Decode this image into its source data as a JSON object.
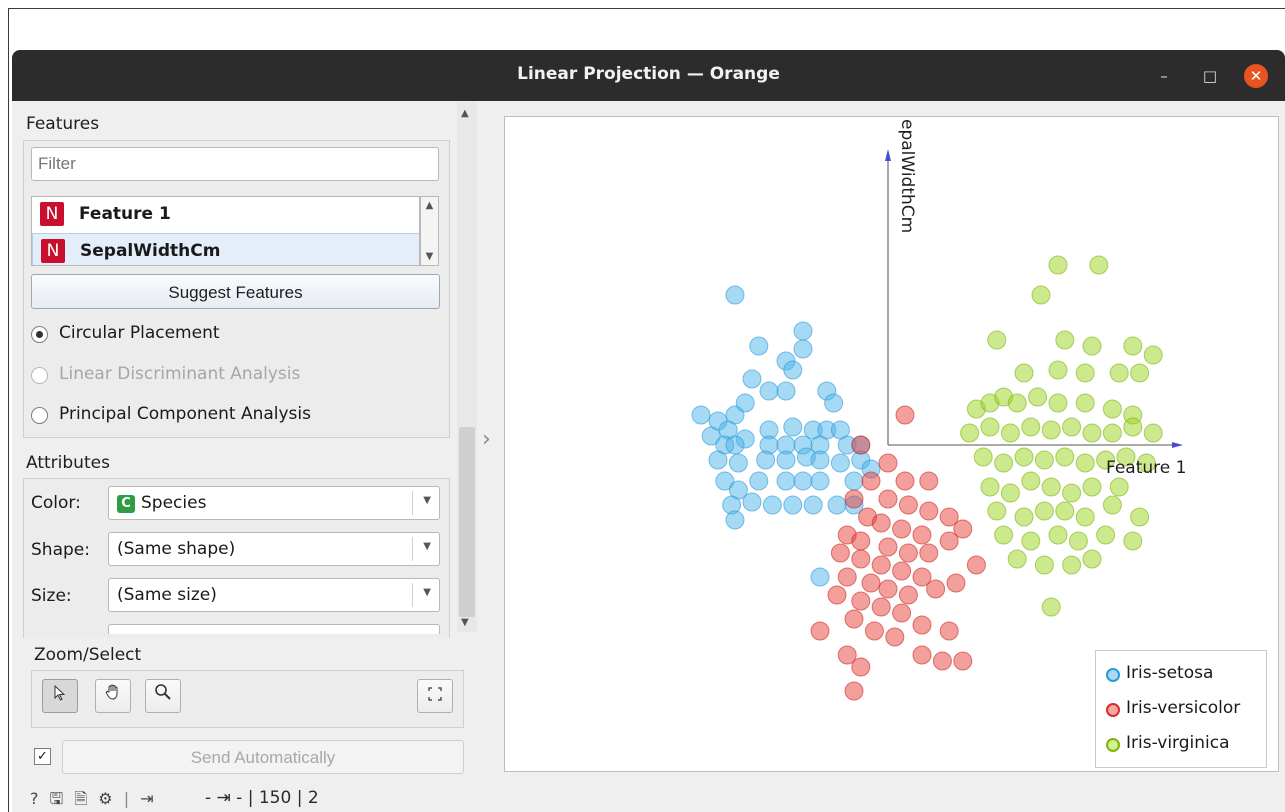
{
  "window": {
    "title": "Linear Projection — Orange",
    "min_icon": "minimize-icon",
    "max_icon": "maximize-icon",
    "close_icon": "close-icon"
  },
  "features": {
    "title": "Features",
    "filter_placeholder": "Filter",
    "items": [
      {
        "badge": "N",
        "label": "Feature 1",
        "selected": false
      },
      {
        "badge": "N",
        "label": "SepalWidthCm",
        "selected": true
      }
    ],
    "suggest_label": "Suggest Features",
    "placements": [
      {
        "label": "Circular Placement",
        "checked": true,
        "enabled": true
      },
      {
        "label": "Linear Discriminant Analysis",
        "checked": false,
        "enabled": false
      },
      {
        "label": "Principal Component Analysis",
        "checked": false,
        "enabled": true
      }
    ]
  },
  "attributes": {
    "title": "Attributes",
    "color": {
      "label": "Color:",
      "badge": "C",
      "value": "Species"
    },
    "shape": {
      "label": "Shape:",
      "value": "(Same shape)"
    },
    "size": {
      "label": "Size:",
      "value": "(Same size)"
    }
  },
  "zoom": {
    "title": "Zoom/Select",
    "tools": [
      "pointer-icon",
      "pan-hand-icon",
      "zoom-icon"
    ],
    "reset_icon": "fit-view-icon"
  },
  "send": {
    "auto_checked": true,
    "label": "Send Automatically"
  },
  "status": {
    "icons": [
      "help-icon",
      "save-icon",
      "report-icon",
      "settings-icon"
    ],
    "text": "- ⇥ - | 150 | 2",
    "input_icon": "input-icon",
    "output_icon": "output-icon"
  },
  "colors": {
    "setosa": "#4db3ea",
    "versicolor": "#e8403a",
    "virginica": "#9bd31c",
    "axis": "#4a4ad6"
  },
  "plot": {
    "axes": [
      {
        "name": "Feature 1"
      },
      {
        "name": "epalWidthCm"
      }
    ],
    "legend": [
      {
        "label": "Iris-setosa",
        "color": "#4db3ea"
      },
      {
        "label": "Iris-versicolor",
        "color": "#e8403a"
      },
      {
        "label": "Iris-virginica",
        "color": "#9bd31c"
      }
    ],
    "points": {
      "setosa": [
        [
          -0.45,
          0.5
        ],
        [
          -0.25,
          0.38
        ],
        [
          -0.25,
          0.32
        ],
        [
          -0.3,
          0.28
        ],
        [
          -0.38,
          0.33
        ],
        [
          -0.28,
          0.25
        ],
        [
          -0.4,
          0.22
        ],
        [
          -0.35,
          0.18
        ],
        [
          -0.45,
          0.1
        ],
        [
          -0.42,
          0.14
        ],
        [
          -0.3,
          0.18
        ],
        [
          -0.18,
          0.18
        ],
        [
          -0.16,
          0.14
        ],
        [
          -0.5,
          0.08
        ],
        [
          -0.47,
          0.05
        ],
        [
          -0.42,
          0.02
        ],
        [
          -0.35,
          0.05
        ],
        [
          -0.28,
          0.06
        ],
        [
          -0.22,
          0.05
        ],
        [
          -0.18,
          0.05
        ],
        [
          -0.14,
          0.05
        ],
        [
          -0.55,
          0.1
        ],
        [
          -0.52,
          0.03
        ],
        [
          -0.48,
          0.0
        ],
        [
          -0.45,
          0.0
        ],
        [
          -0.35,
          0.0
        ],
        [
          -0.3,
          0.0
        ],
        [
          -0.25,
          0.0
        ],
        [
          -0.2,
          0.0
        ],
        [
          -0.12,
          0.0
        ],
        [
          -0.08,
          0.0
        ],
        [
          -0.5,
          -0.05
        ],
        [
          -0.44,
          -0.06
        ],
        [
          -0.36,
          -0.05
        ],
        [
          -0.3,
          -0.05
        ],
        [
          -0.24,
          -0.04
        ],
        [
          -0.2,
          -0.05
        ],
        [
          -0.14,
          -0.06
        ],
        [
          -0.08,
          -0.05
        ],
        [
          -0.05,
          -0.08
        ],
        [
          -0.48,
          -0.12
        ],
        [
          -0.44,
          -0.15
        ],
        [
          -0.38,
          -0.12
        ],
        [
          -0.3,
          -0.12
        ],
        [
          -0.25,
          -0.12
        ],
        [
          -0.2,
          -0.12
        ],
        [
          -0.1,
          -0.12
        ],
        [
          -0.46,
          -0.2
        ],
        [
          -0.4,
          -0.19
        ],
        [
          -0.34,
          -0.2
        ],
        [
          -0.28,
          -0.2
        ],
        [
          -0.22,
          -0.2
        ],
        [
          -0.15,
          -0.2
        ],
        [
          -0.1,
          -0.2
        ],
        [
          -0.45,
          -0.25
        ],
        [
          -0.2,
          -0.44
        ]
      ],
      "versicolor": [
        [
          0.05,
          0.1
        ],
        [
          -0.08,
          0.0
        ],
        [
          0.0,
          -0.06
        ],
        [
          -0.05,
          -0.12
        ],
        [
          0.05,
          -0.12
        ],
        [
          0.12,
          -0.12
        ],
        [
          -0.1,
          -0.18
        ],
        [
          0.0,
          -0.18
        ],
        [
          0.06,
          -0.2
        ],
        [
          0.12,
          -0.22
        ],
        [
          0.18,
          -0.24
        ],
        [
          -0.06,
          -0.24
        ],
        [
          -0.02,
          -0.26
        ],
        [
          0.04,
          -0.28
        ],
        [
          0.1,
          -0.3
        ],
        [
          -0.12,
          -0.3
        ],
        [
          -0.08,
          -0.32
        ],
        [
          0.0,
          -0.34
        ],
        [
          0.06,
          -0.36
        ],
        [
          0.12,
          -0.36
        ],
        [
          0.18,
          -0.32
        ],
        [
          0.22,
          -0.28
        ],
        [
          -0.14,
          -0.36
        ],
        [
          -0.08,
          -0.38
        ],
        [
          -0.02,
          -0.4
        ],
        [
          0.04,
          -0.42
        ],
        [
          0.1,
          -0.44
        ],
        [
          -0.12,
          -0.44
        ],
        [
          -0.05,
          -0.46
        ],
        [
          0.0,
          -0.48
        ],
        [
          0.06,
          -0.5
        ],
        [
          0.14,
          -0.48
        ],
        [
          0.2,
          -0.46
        ],
        [
          0.26,
          -0.4
        ],
        [
          -0.15,
          -0.5
        ],
        [
          -0.08,
          -0.52
        ],
        [
          -0.02,
          -0.54
        ],
        [
          0.04,
          -0.56
        ],
        [
          0.1,
          -0.6
        ],
        [
          0.18,
          -0.62
        ],
        [
          -0.1,
          -0.58
        ],
        [
          -0.04,
          -0.62
        ],
        [
          0.02,
          -0.64
        ],
        [
          -0.2,
          -0.62
        ],
        [
          -0.12,
          -0.7
        ],
        [
          -0.08,
          -0.74
        ],
        [
          -0.1,
          -0.82
        ],
        [
          0.1,
          -0.7
        ],
        [
          0.16,
          -0.72
        ],
        [
          0.22,
          -0.72
        ]
      ],
      "virginica": [
        [
          0.5,
          0.6
        ],
        [
          0.62,
          0.6
        ],
        [
          0.45,
          0.5
        ],
        [
          0.32,
          0.35
        ],
        [
          0.52,
          0.35
        ],
        [
          0.6,
          0.33
        ],
        [
          0.72,
          0.33
        ],
        [
          0.78,
          0.3
        ],
        [
          0.4,
          0.24
        ],
        [
          0.5,
          0.25
        ],
        [
          0.58,
          0.24
        ],
        [
          0.68,
          0.24
        ],
        [
          0.74,
          0.24
        ],
        [
          0.26,
          0.12
        ],
        [
          0.3,
          0.14
        ],
        [
          0.34,
          0.16
        ],
        [
          0.38,
          0.14
        ],
        [
          0.44,
          0.16
        ],
        [
          0.5,
          0.14
        ],
        [
          0.58,
          0.14
        ],
        [
          0.66,
          0.12
        ],
        [
          0.72,
          0.1
        ],
        [
          0.24,
          0.04
        ],
        [
          0.3,
          0.06
        ],
        [
          0.36,
          0.04
        ],
        [
          0.42,
          0.06
        ],
        [
          0.48,
          0.05
        ],
        [
          0.54,
          0.06
        ],
        [
          0.6,
          0.04
        ],
        [
          0.66,
          0.04
        ],
        [
          0.72,
          0.06
        ],
        [
          0.78,
          0.04
        ],
        [
          0.28,
          -0.04
        ],
        [
          0.34,
          -0.06
        ],
        [
          0.4,
          -0.04
        ],
        [
          0.46,
          -0.05
        ],
        [
          0.52,
          -0.04
        ],
        [
          0.58,
          -0.06
        ],
        [
          0.64,
          -0.05
        ],
        [
          0.7,
          -0.04
        ],
        [
          0.76,
          -0.06
        ],
        [
          0.3,
          -0.14
        ],
        [
          0.36,
          -0.16
        ],
        [
          0.42,
          -0.12
        ],
        [
          0.48,
          -0.14
        ],
        [
          0.54,
          -0.16
        ],
        [
          0.6,
          -0.14
        ],
        [
          0.68,
          -0.14
        ],
        [
          0.32,
          -0.22
        ],
        [
          0.4,
          -0.24
        ],
        [
          0.46,
          -0.22
        ],
        [
          0.52,
          -0.22
        ],
        [
          0.58,
          -0.24
        ],
        [
          0.66,
          -0.2
        ],
        [
          0.74,
          -0.24
        ],
        [
          0.34,
          -0.3
        ],
        [
          0.42,
          -0.32
        ],
        [
          0.5,
          -0.3
        ],
        [
          0.56,
          -0.32
        ],
        [
          0.64,
          -0.3
        ],
        [
          0.72,
          -0.32
        ],
        [
          0.38,
          -0.38
        ],
        [
          0.46,
          -0.4
        ],
        [
          0.54,
          -0.4
        ],
        [
          0.6,
          -0.38
        ],
        [
          0.48,
          -0.54
        ]
      ]
    }
  }
}
